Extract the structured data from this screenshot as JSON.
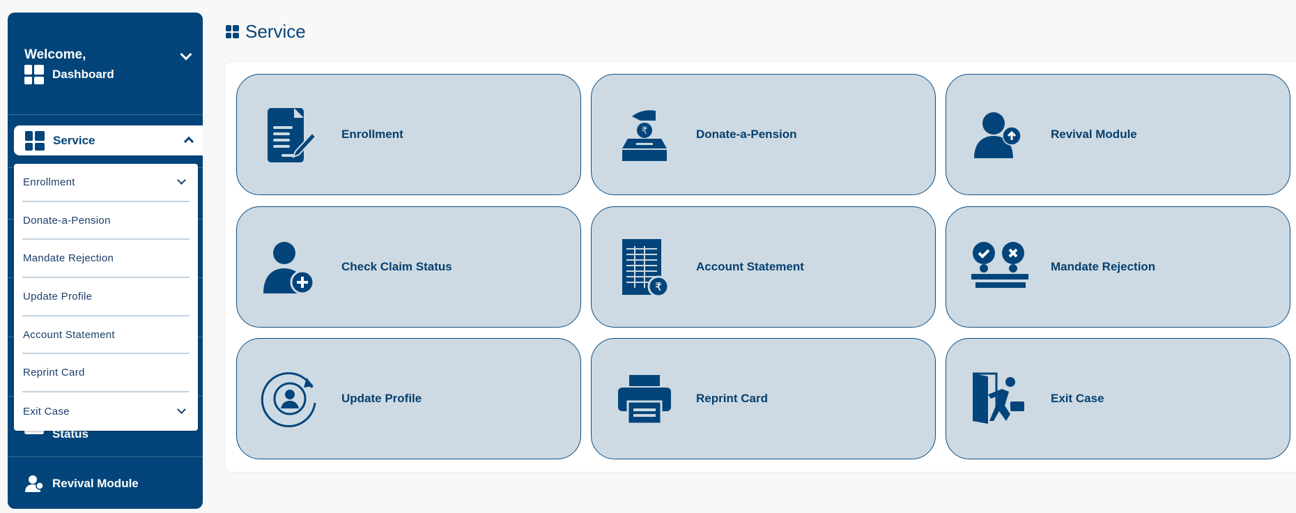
{
  "sidebar": {
    "welcome": "Welcome,",
    "dashboard": "Dashboard",
    "service": "Service",
    "hidden_item_partial": "Status",
    "revival": "Revival Module",
    "dropdown": [
      {
        "label": "Enrollment",
        "has_children": true
      },
      {
        "label": "Donate-a-Pension",
        "has_children": false
      },
      {
        "label": "Mandate Rejection",
        "has_children": false
      },
      {
        "label": "Update Profile",
        "has_children": false
      },
      {
        "label": "Account Statement",
        "has_children": false
      },
      {
        "label": "Reprint Card",
        "has_children": false
      },
      {
        "label": "Exit Case",
        "has_children": true
      }
    ]
  },
  "page": {
    "title": "Service"
  },
  "cards": [
    {
      "label": "Enrollment",
      "icon": "document-pen-icon"
    },
    {
      "label": "Donate-a-Pension",
      "icon": "rupee-donation-box-icon"
    },
    {
      "label": "Revival Module",
      "icon": "user-upload-icon"
    },
    {
      "label": "Check Claim Status",
      "icon": "user-plus-icon"
    },
    {
      "label": "Account Statement",
      "icon": "spreadsheet-rupee-icon"
    },
    {
      "label": "Mandate Rejection",
      "icon": "approve-reject-icon"
    },
    {
      "label": "Update Profile",
      "icon": "profile-refresh-icon"
    },
    {
      "label": "Reprint Card",
      "icon": "printer-icon"
    },
    {
      "label": "Exit Case",
      "icon": "exit-door-icon"
    }
  ],
  "colors": {
    "primary": "#03457a",
    "card_bg": "#cddae3",
    "background": "#f8f8f8"
  }
}
